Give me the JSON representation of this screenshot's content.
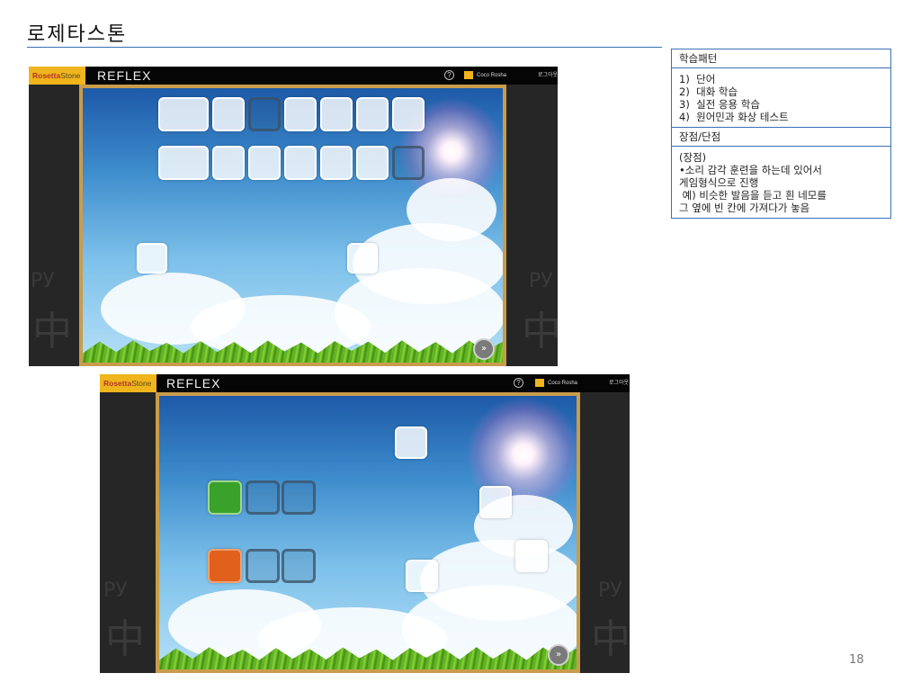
{
  "slide": {
    "title": "로제타스톤",
    "page_number": "18"
  },
  "side_table": {
    "learning_pattern_header": "학습패턴",
    "learning_pattern_items": [
      "1)  단어",
      "2)  대화 학습",
      "3)  실전 응용 학습",
      "4)  원어민과 화상 테스트"
    ],
    "pros_cons_header": "장점/단점",
    "pros_cons_lines": [
      "(장점)",
      "•소리 감각 훈련을 하는데 있어서",
      "게임형식으로 진행",
      " 예) 비슷한 발음을 듣고 흰 네모를",
      "그 옆에 빈 칸에 가져다가 놓음"
    ]
  },
  "app": {
    "brand_bold": "Rosetta",
    "brand_thin": "Stone",
    "product": "REFLEX",
    "user_name": "Coco Rosha",
    "logout_label": "로그아웃",
    "help_glyph": "?",
    "next_glyph": "»"
  },
  "colors": {
    "accent_rule": "#3a6fb5",
    "brand_yellow": "#f0b41c",
    "board_frame": "#c99c4c",
    "tile_green": "#3aa12a",
    "tile_orange": "#e1601c"
  }
}
